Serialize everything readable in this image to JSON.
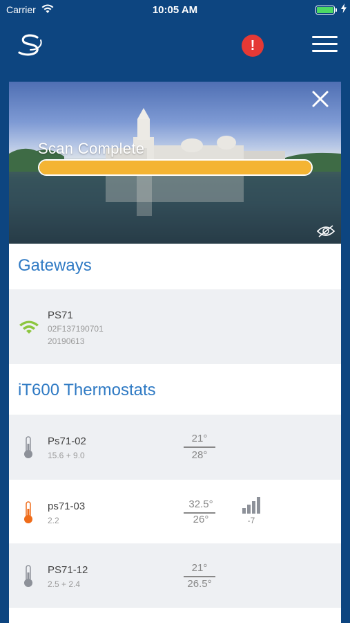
{
  "status_bar": {
    "carrier": "Carrier",
    "time": "10:05 AM"
  },
  "nav": {
    "alert_label": "!"
  },
  "hero": {
    "scan_label": "Scan Complete",
    "progress_fraction": 1.0
  },
  "gateways": {
    "title": "Gateways",
    "items": [
      {
        "name": "PS71",
        "line1": "02F137190701",
        "line2": "20190613"
      }
    ]
  },
  "thermostats": {
    "title": "iT600 Thermostats",
    "items": [
      {
        "name": "Ps71-02",
        "detail": "15.6 + 9.0",
        "setpoint": "21°",
        "current": "28°",
        "icon_color": "#8d9199"
      },
      {
        "name": "ps71-03",
        "detail": "2.2",
        "setpoint": "32.5°",
        "current": "26°",
        "signal": "-7",
        "icon_color": "#ef6c1a"
      },
      {
        "name": "PS71-12",
        "detail": "2.5 + 2.4",
        "setpoint": "21°",
        "current": "26.5°",
        "icon_color": "#8d9199"
      }
    ]
  },
  "colors": {
    "brand": "#0d4580",
    "accent": "#2f7ac4",
    "progress": "#f4b433",
    "wifi": "#8cc63e",
    "alert": "#e53935"
  }
}
